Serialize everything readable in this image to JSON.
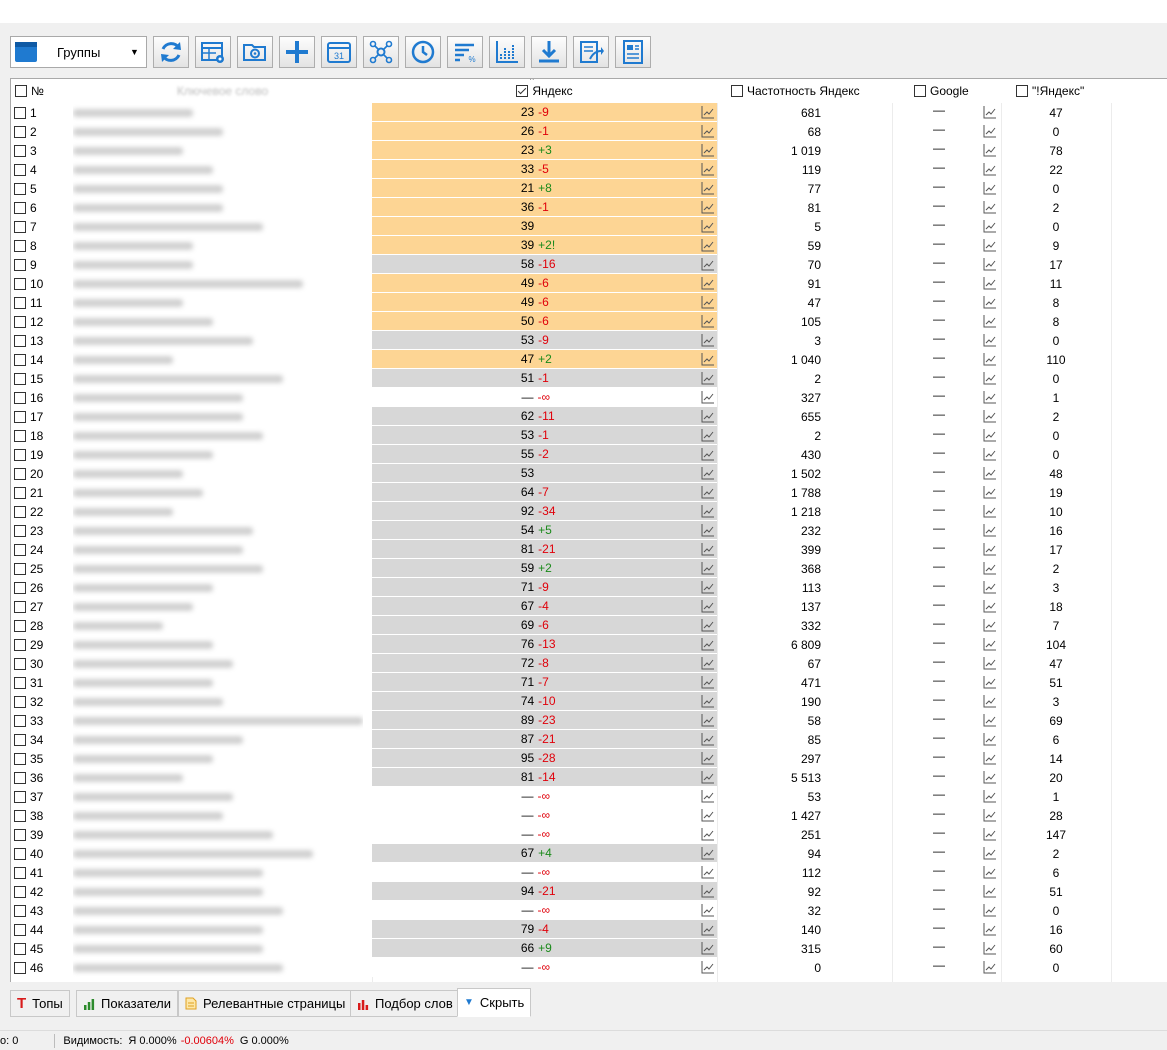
{
  "toolbar": {
    "groups_label": "Группы",
    "buttons": [
      "refresh-icon",
      "table-settings-icon",
      "folder-settings-icon",
      "add-icon",
      "calendar-icon",
      "network-icon",
      "clock-icon",
      "sort-percent-icon",
      "chart-dots-icon",
      "download-icon",
      "export-icon",
      "report-icon"
    ],
    "calendar_day": "31",
    "accent_color": "#1f7ad0"
  },
  "grid": {
    "headers": {
      "num": "№",
      "keyword": "Ключевое слово",
      "yandex": "Яндекс",
      "yandex_freq": "Частотность Яндекс",
      "google": "Google",
      "exact_yandex": "\"!Яндекс\""
    },
    "rows": [
      {
        "n": "1",
        "pos": "23",
        "d": "-9",
        "s": "orange",
        "f": "681",
        "g": "—",
        "e": "47"
      },
      {
        "n": "2",
        "pos": "26",
        "d": "-1",
        "s": "orange",
        "f": "68",
        "g": "—",
        "e": "0"
      },
      {
        "n": "3",
        "pos": "23",
        "d": "+3",
        "s": "orange",
        "f": "1 019",
        "g": "—",
        "e": "78"
      },
      {
        "n": "4",
        "pos": "33",
        "d": "-5",
        "s": "orange",
        "f": "119",
        "g": "—",
        "e": "22"
      },
      {
        "n": "5",
        "pos": "21",
        "d": "+8",
        "s": "orange",
        "f": "77",
        "g": "—",
        "e": "0"
      },
      {
        "n": "6",
        "pos": "36",
        "d": "-1",
        "s": "orange",
        "f": "81",
        "g": "—",
        "e": "2"
      },
      {
        "n": "7",
        "pos": "39",
        "d": "",
        "s": "orange",
        "f": "5",
        "g": "—",
        "e": "0"
      },
      {
        "n": "8",
        "pos": "39",
        "d": "+2!",
        "s": "orange",
        "f": "59",
        "g": "—",
        "e": "9"
      },
      {
        "n": "9",
        "pos": "58",
        "d": "-16",
        "s": "gray",
        "f": "70",
        "g": "—",
        "e": "17"
      },
      {
        "n": "10",
        "pos": "49",
        "d": "-6",
        "s": "orange",
        "f": "91",
        "g": "—",
        "e": "11"
      },
      {
        "n": "11",
        "pos": "49",
        "d": "-6",
        "s": "orange",
        "f": "47",
        "g": "—",
        "e": "8"
      },
      {
        "n": "12",
        "pos": "50",
        "d": "-6",
        "s": "orange",
        "f": "105",
        "g": "—",
        "e": "8"
      },
      {
        "n": "13",
        "pos": "53",
        "d": "-9",
        "s": "gray",
        "f": "3",
        "g": "—",
        "e": "0"
      },
      {
        "n": "14",
        "pos": "47",
        "d": "+2",
        "s": "orange",
        "f": "1 040",
        "g": "—",
        "e": "110"
      },
      {
        "n": "15",
        "pos": "51",
        "d": "-1",
        "s": "gray",
        "f": "2",
        "g": "—",
        "e": "0"
      },
      {
        "n": "16",
        "pos": "—",
        "d": "-∞",
        "s": "white",
        "f": "327",
        "g": "—",
        "e": "1"
      },
      {
        "n": "17",
        "pos": "62",
        "d": "-11",
        "s": "gray",
        "f": "655",
        "g": "—",
        "e": "2"
      },
      {
        "n": "18",
        "pos": "53",
        "d": "-1",
        "s": "gray",
        "f": "2",
        "g": "—",
        "e": "0"
      },
      {
        "n": "19",
        "pos": "55",
        "d": "-2",
        "s": "gray",
        "f": "430",
        "g": "—",
        "e": "0"
      },
      {
        "n": "20",
        "pos": "53",
        "d": "",
        "s": "gray",
        "f": "1 502",
        "g": "—",
        "e": "48"
      },
      {
        "n": "21",
        "pos": "64",
        "d": "-7",
        "s": "gray",
        "f": "1 788",
        "g": "—",
        "e": "19"
      },
      {
        "n": "22",
        "pos": "92",
        "d": "-34",
        "s": "gray",
        "f": "1 218",
        "g": "—",
        "e": "10"
      },
      {
        "n": "23",
        "pos": "54",
        "d": "+5",
        "s": "gray",
        "f": "232",
        "g": "—",
        "e": "16"
      },
      {
        "n": "24",
        "pos": "81",
        "d": "-21",
        "s": "gray",
        "f": "399",
        "g": "—",
        "e": "17"
      },
      {
        "n": "25",
        "pos": "59",
        "d": "+2",
        "s": "gray",
        "f": "368",
        "g": "—",
        "e": "2"
      },
      {
        "n": "26",
        "pos": "71",
        "d": "-9",
        "s": "gray",
        "f": "113",
        "g": "—",
        "e": "3"
      },
      {
        "n": "27",
        "pos": "67",
        "d": "-4",
        "s": "gray",
        "f": "137",
        "g": "—",
        "e": "18"
      },
      {
        "n": "28",
        "pos": "69",
        "d": "-6",
        "s": "gray",
        "f": "332",
        "g": "—",
        "e": "7"
      },
      {
        "n": "29",
        "pos": "76",
        "d": "-13",
        "s": "gray",
        "f": "6 809",
        "g": "—",
        "e": "104"
      },
      {
        "n": "30",
        "pos": "72",
        "d": "-8",
        "s": "gray",
        "f": "67",
        "g": "—",
        "e": "47"
      },
      {
        "n": "31",
        "pos": "71",
        "d": "-7",
        "s": "gray",
        "f": "471",
        "g": "—",
        "e": "51"
      },
      {
        "n": "32",
        "pos": "74",
        "d": "-10",
        "s": "gray",
        "f": "190",
        "g": "—",
        "e": "3"
      },
      {
        "n": "33",
        "pos": "89",
        "d": "-23",
        "s": "gray",
        "f": "58",
        "g": "—",
        "e": "69"
      },
      {
        "n": "34",
        "pos": "87",
        "d": "-21",
        "s": "gray",
        "f": "85",
        "g": "—",
        "e": "6"
      },
      {
        "n": "35",
        "pos": "95",
        "d": "-28",
        "s": "gray",
        "f": "297",
        "g": "—",
        "e": "14"
      },
      {
        "n": "36",
        "pos": "81",
        "d": "-14",
        "s": "gray",
        "f": "5 513",
        "g": "—",
        "e": "20"
      },
      {
        "n": "37",
        "pos": "—",
        "d": "-∞",
        "s": "white",
        "f": "53",
        "g": "—",
        "e": "1"
      },
      {
        "n": "38",
        "pos": "—",
        "d": "-∞",
        "s": "white",
        "f": "1 427",
        "g": "—",
        "e": "28"
      },
      {
        "n": "39",
        "pos": "—",
        "d": "-∞",
        "s": "white",
        "f": "251",
        "g": "—",
        "e": "147"
      },
      {
        "n": "40",
        "pos": "67",
        "d": "+4",
        "s": "gray",
        "f": "94",
        "g": "—",
        "e": "2"
      },
      {
        "n": "41",
        "pos": "—",
        "d": "-∞",
        "s": "white",
        "f": "112",
        "g": "—",
        "e": "6"
      },
      {
        "n": "42",
        "pos": "94",
        "d": "-21",
        "s": "gray",
        "f": "92",
        "g": "—",
        "e": "51"
      },
      {
        "n": "43",
        "pos": "—",
        "d": "-∞",
        "s": "white",
        "f": "32",
        "g": "—",
        "e": "0"
      },
      {
        "n": "44",
        "pos": "79",
        "d": "-4",
        "s": "gray",
        "f": "140",
        "g": "—",
        "e": "16"
      },
      {
        "n": "45",
        "pos": "66",
        "d": "+9",
        "s": "gray",
        "f": "315",
        "g": "—",
        "e": "60"
      },
      {
        "n": "46",
        "pos": "—",
        "d": "-∞",
        "s": "white",
        "f": "0",
        "g": "—",
        "e": "0"
      }
    ],
    "shade_colors": {
      "orange": "#fdd594",
      "gray": "#d7d7d7",
      "white": "#ffffff"
    }
  },
  "tabs": [
    {
      "label": "Топы",
      "icon": "tops-t-icon"
    },
    {
      "label": "Показатели",
      "icon": "bar-chart-icon"
    },
    {
      "label": "Релевантные страницы",
      "icon": "page-icon"
    },
    {
      "label": "Подбор слов",
      "icon": "word-chart-icon"
    },
    {
      "label": "Скрыть",
      "icon": "collapse-arrow-icon"
    }
  ],
  "status": {
    "left": "о: 0",
    "visibility_label": "Видимость:",
    "ya_prefix": "Я",
    "ya_value": "0.000%",
    "ya_change": "-0.00604%",
    "g_prefix": "G",
    "g_value": "0.000%"
  }
}
